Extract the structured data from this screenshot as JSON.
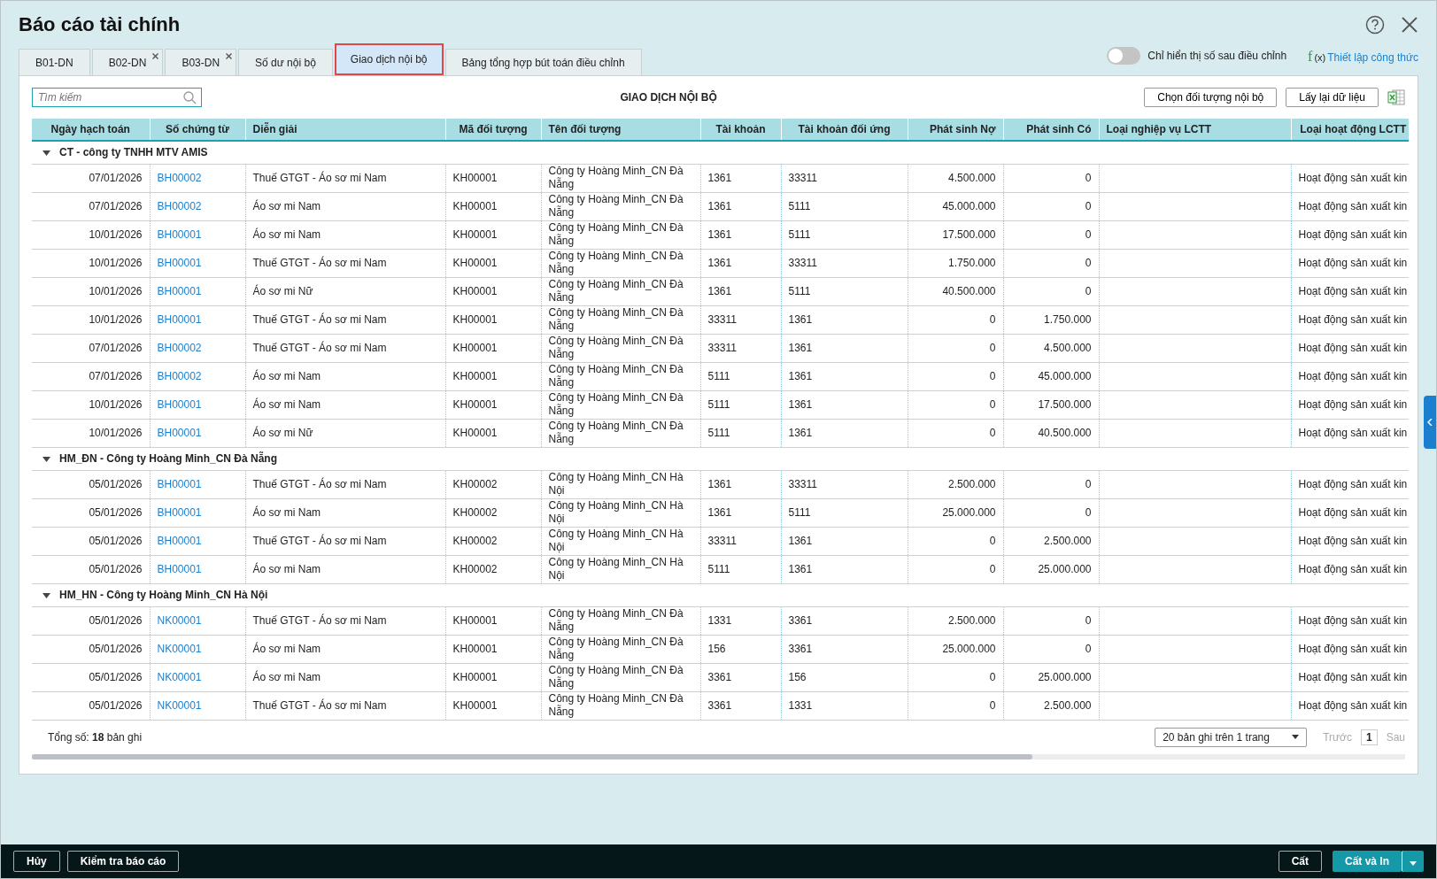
{
  "window": {
    "title": "Báo cáo tài chính"
  },
  "tabs": [
    {
      "label": "B01-DN",
      "selected": false,
      "closable": false
    },
    {
      "label": "B02-DN",
      "selected": false,
      "closable": true
    },
    {
      "label": "B03-DN",
      "selected": false,
      "closable": true
    },
    {
      "label": "Số dư nội bộ",
      "selected": false,
      "closable": false
    },
    {
      "label": "Giao dịch nội bộ",
      "selected": true,
      "closable": false
    },
    {
      "label": "Bảng tổng hợp bút toán điều chỉnh",
      "selected": false,
      "closable": false
    }
  ],
  "adjusted_only_toggle": {
    "label": "Chỉ hiển thị số sau điều chỉnh",
    "on": false
  },
  "formula_link": {
    "icon_text": "f",
    "icon_sub": "(x)",
    "label": "Thiết lập công thức"
  },
  "search": {
    "placeholder": "Tìm kiếm"
  },
  "report_title": "GIAO DỊCH NỘI BỘ",
  "toolbar_buttons": [
    "Chọn đối tượng nội bộ",
    "Lấy lại dữ liệu"
  ],
  "table": {
    "columns": [
      "Ngày hạch toán",
      "Số chứng từ",
      "Diễn giải",
      "Mã đối tượng",
      "Tên đối tượng",
      "Tài khoản",
      "Tài khoản đối ứng",
      "Phát sinh Nợ",
      "Phát sinh Có",
      "Loại nghiệp vụ LCTT",
      "Loại hoạt động LCTT"
    ],
    "groups": [
      {
        "label": "CT - công ty TNHH MTV AMIS",
        "expanded": true,
        "rows": [
          {
            "date": "07/01/2026",
            "voucher": "BH00002",
            "description": "Thuế GTGT - Áo sơ mi Nam",
            "object_code": "KH00001",
            "object_name": "Công ty Hoàng Minh_CN Đà Nẵng",
            "account": "1361",
            "contra_account": "33311",
            "debit": "4.500.000",
            "credit": "0",
            "activity": "Hoạt động sản xuất kin"
          },
          {
            "date": "07/01/2026",
            "voucher": "BH00002",
            "description": "Áo sơ mi Nam",
            "object_code": "KH00001",
            "object_name": "Công ty Hoàng Minh_CN Đà Nẵng",
            "account": "1361",
            "contra_account": "5111",
            "debit": "45.000.000",
            "credit": "0",
            "activity": "Hoạt động sản xuất kin"
          },
          {
            "date": "10/01/2026",
            "voucher": "BH00001",
            "description": "Áo sơ mi Nam",
            "object_code": "KH00001",
            "object_name": "Công ty Hoàng Minh_CN Đà Nẵng",
            "account": "1361",
            "contra_account": "5111",
            "debit": "17.500.000",
            "credit": "0",
            "activity": "Hoạt động sản xuất kin"
          },
          {
            "date": "10/01/2026",
            "voucher": "BH00001",
            "description": "Thuế GTGT - Áo sơ mi Nam",
            "object_code": "KH00001",
            "object_name": "Công ty Hoàng Minh_CN Đà Nẵng",
            "account": "1361",
            "contra_account": "33311",
            "debit": "1.750.000",
            "credit": "0",
            "activity": "Hoạt động sản xuất kin"
          },
          {
            "date": "10/01/2026",
            "voucher": "BH00001",
            "description": "Áo sơ mi Nữ",
            "object_code": "KH00001",
            "object_name": "Công ty Hoàng Minh_CN Đà Nẵng",
            "account": "1361",
            "contra_account": "5111",
            "debit": "40.500.000",
            "credit": "0",
            "activity": "Hoạt động sản xuất kin"
          },
          {
            "date": "10/01/2026",
            "voucher": "BH00001",
            "description": "Thuế GTGT - Áo sơ mi Nam",
            "object_code": "KH00001",
            "object_name": "Công ty Hoàng Minh_CN Đà Nẵng",
            "account": "33311",
            "contra_account": "1361",
            "debit": "0",
            "credit": "1.750.000",
            "activity": "Hoạt động sản xuất kin"
          },
          {
            "date": "07/01/2026",
            "voucher": "BH00002",
            "description": "Thuế GTGT - Áo sơ mi Nam",
            "object_code": "KH00001",
            "object_name": "Công ty Hoàng Minh_CN Đà Nẵng",
            "account": "33311",
            "contra_account": "1361",
            "debit": "0",
            "credit": "4.500.000",
            "activity": "Hoạt động sản xuất kin"
          },
          {
            "date": "07/01/2026",
            "voucher": "BH00002",
            "description": "Áo sơ mi Nam",
            "object_code": "KH00001",
            "object_name": "Công ty Hoàng Minh_CN Đà Nẵng",
            "account": "5111",
            "contra_account": "1361",
            "debit": "0",
            "credit": "45.000.000",
            "activity": "Hoạt động sản xuất kin"
          },
          {
            "date": "10/01/2026",
            "voucher": "BH00001",
            "description": "Áo sơ mi Nam",
            "object_code": "KH00001",
            "object_name": "Công ty Hoàng Minh_CN Đà Nẵng",
            "account": "5111",
            "contra_account": "1361",
            "debit": "0",
            "credit": "17.500.000",
            "activity": "Hoạt động sản xuất kin"
          },
          {
            "date": "10/01/2026",
            "voucher": "BH00001",
            "description": "Áo sơ mi Nữ",
            "object_code": "KH00001",
            "object_name": "Công ty Hoàng Minh_CN Đà Nẵng",
            "account": "5111",
            "contra_account": "1361",
            "debit": "0",
            "credit": "40.500.000",
            "activity": "Hoạt động sản xuất kin"
          }
        ]
      },
      {
        "label": "HM_ĐN - Công ty Hoàng Minh_CN Đà Nẵng",
        "expanded": true,
        "rows": [
          {
            "date": "05/01/2026",
            "voucher": "BH00001",
            "description": "Thuế GTGT - Áo sơ mi Nam",
            "object_code": "KH00002",
            "object_name": "Công ty Hoàng Minh_CN Hà Nội",
            "account": "1361",
            "contra_account": "33311",
            "debit": "2.500.000",
            "credit": "0",
            "activity": "Hoạt động sản xuất kin"
          },
          {
            "date": "05/01/2026",
            "voucher": "BH00001",
            "description": "Áo sơ mi Nam",
            "object_code": "KH00002",
            "object_name": "Công ty Hoàng Minh_CN Hà Nội",
            "account": "1361",
            "contra_account": "5111",
            "debit": "25.000.000",
            "credit": "0",
            "activity": "Hoạt động sản xuất kin"
          },
          {
            "date": "05/01/2026",
            "voucher": "BH00001",
            "description": "Thuế GTGT - Áo sơ mi Nam",
            "object_code": "KH00002",
            "object_name": "Công ty Hoàng Minh_CN Hà Nội",
            "account": "33311",
            "contra_account": "1361",
            "debit": "0",
            "credit": "2.500.000",
            "activity": "Hoạt động sản xuất kin"
          },
          {
            "date": "05/01/2026",
            "voucher": "BH00001",
            "description": "Áo sơ mi Nam",
            "object_code": "KH00002",
            "object_name": "Công ty Hoàng Minh_CN Hà Nội",
            "account": "5111",
            "contra_account": "1361",
            "debit": "0",
            "credit": "25.000.000",
            "activity": "Hoạt động sản xuất kin"
          }
        ]
      },
      {
        "label": "HM_HN - Công ty Hoàng Minh_CN Hà Nội",
        "expanded": true,
        "rows": [
          {
            "date": "05/01/2026",
            "voucher": "NK00001",
            "description": "Thuế GTGT - Áo sơ mi Nam",
            "object_code": "KH00001",
            "object_name": "Công ty Hoàng Minh_CN Đà Nẵng",
            "account": "1331",
            "contra_account": "3361",
            "debit": "2.500.000",
            "credit": "0",
            "activity": "Hoạt động sản xuất kin"
          },
          {
            "date": "05/01/2026",
            "voucher": "NK00001",
            "description": "Áo sơ mi Nam",
            "object_code": "KH00001",
            "object_name": "Công ty Hoàng Minh_CN Đà Nẵng",
            "account": "156",
            "contra_account": "3361",
            "debit": "25.000.000",
            "credit": "0",
            "activity": "Hoạt động sản xuất kin"
          },
          {
            "date": "05/01/2026",
            "voucher": "NK00001",
            "description": "Áo sơ mi Nam",
            "object_code": "KH00001",
            "object_name": "Công ty Hoàng Minh_CN Đà Nẵng",
            "account": "3361",
            "contra_account": "156",
            "debit": "0",
            "credit": "25.000.000",
            "activity": "Hoạt động sản xuất kin"
          },
          {
            "date": "05/01/2026",
            "voucher": "NK00001",
            "description": "Thuế GTGT - Áo sơ mi Nam",
            "object_code": "KH00001",
            "object_name": "Công ty Hoàng Minh_CN Đà Nẵng",
            "account": "3361",
            "contra_account": "1331",
            "debit": "0",
            "credit": "2.500.000",
            "activity": "Hoạt động sản xuất kin"
          }
        ]
      }
    ]
  },
  "footer": {
    "total": "Tổng số: **18** bản ghi",
    "page_size": "20 bản ghi trên 1 trang",
    "prev": {
      "label": "Trước",
      "disabled": true
    },
    "page": "1",
    "next": {
      "label": "Sau",
      "disabled": true
    }
  },
  "bottom_bar": {
    "left_buttons": [
      "Hủy",
      "Kiểm tra báo cáo"
    ],
    "save": "Cất",
    "save_print": "Cất và In"
  }
}
